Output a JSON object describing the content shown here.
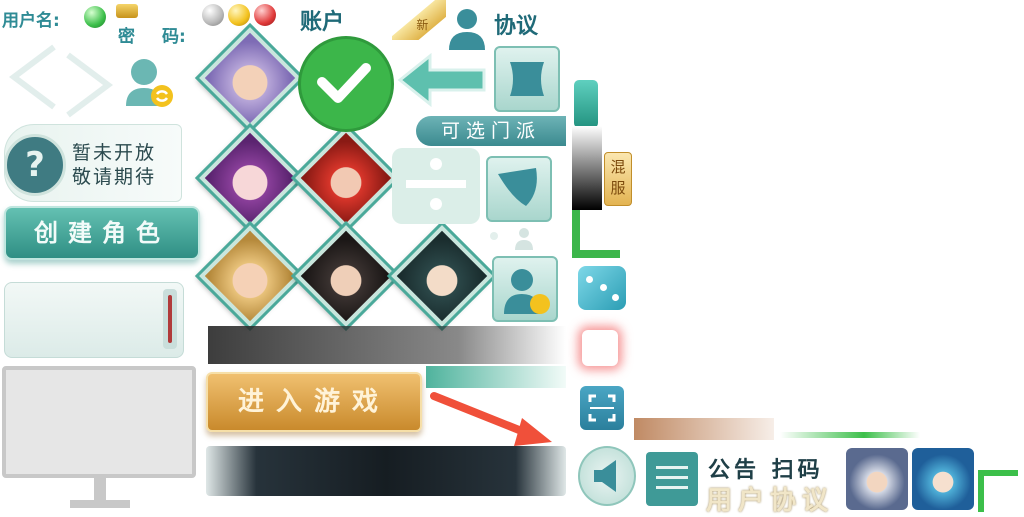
{
  "login": {
    "username_label": "用户名:",
    "password_label_1": "密",
    "password_label_2": "码:",
    "account_label": "账户",
    "agreement_label": "协议",
    "new_badge": "新"
  },
  "notice_box": {
    "line1": "暂未开放",
    "line2": "敬请期待"
  },
  "buttons": {
    "create_role": "创建角色",
    "enter_game": "进入游戏"
  },
  "faction_tab": "可选门派",
  "mixed_server_tag": "混服",
  "bottom": {
    "notice_scan": "公告 扫码",
    "user_agreement": "用户协议"
  },
  "colors": {
    "teal_accent": "#3aa595",
    "green_check": "#3cb64a",
    "gold_button": "#d9a146",
    "red_arrow": "#f0503a"
  }
}
